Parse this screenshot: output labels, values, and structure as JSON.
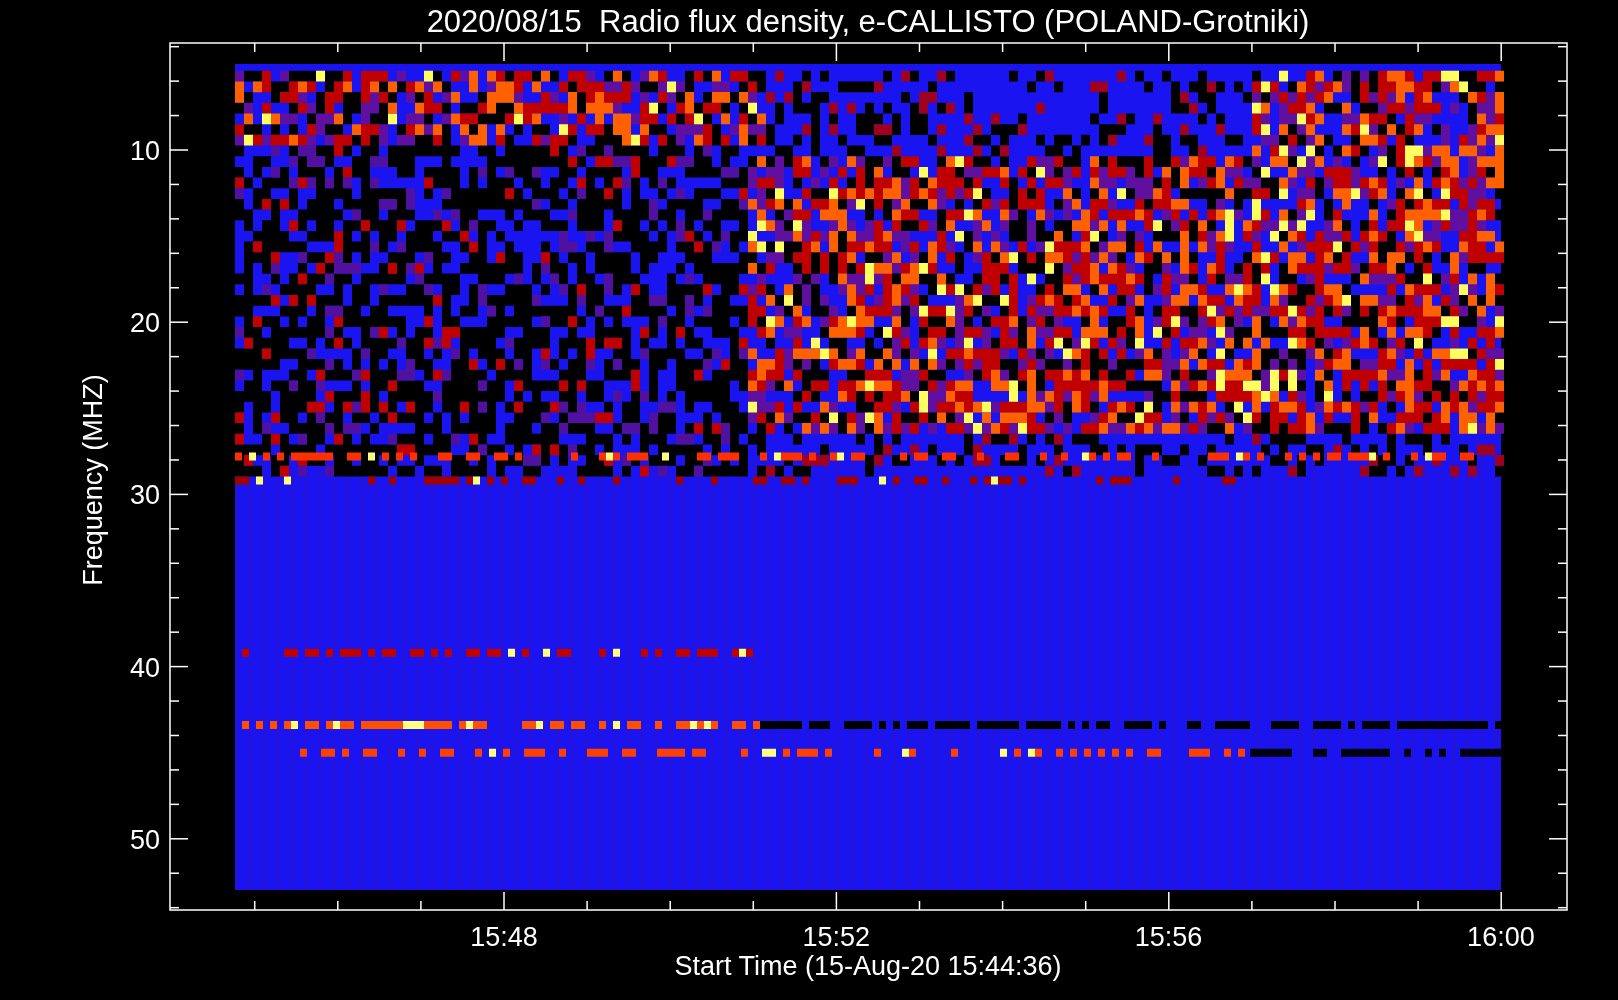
{
  "title": "2020/08/15  Radio flux density, e-CALLISTO (POLAND-Grotniki)",
  "ylabel": "Frequency (MHZ)",
  "xlabel": "Start Time (15-Aug-20 15:44:36)",
  "yticks": [
    "10",
    "20",
    "30",
    "40",
    "50"
  ],
  "xticks": [
    "15:48",
    "15:52",
    "15:56",
    "16:00"
  ]
}
